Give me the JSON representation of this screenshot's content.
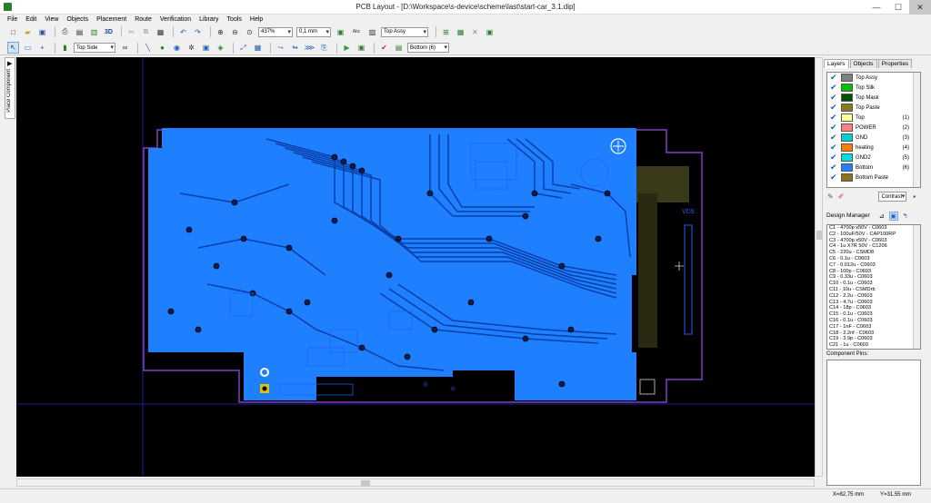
{
  "window": {
    "title": "PCB Layout - [D:\\Workspace\\s-device\\scheme\\last\\start-car_3.1.dip]",
    "min": "—",
    "max": "☐",
    "close": "✕"
  },
  "menu": [
    "File",
    "Edit",
    "View",
    "Objects",
    "Placement",
    "Route",
    "Verification",
    "Library",
    "Tools",
    "Help"
  ],
  "toolbar": {
    "zoom": "437%",
    "grid": "0,1 mm",
    "layer": "Top Assy",
    "side": "Top Side",
    "bottom": "Bottom (6)",
    "view3d": "3D",
    "abc": "Abc"
  },
  "sidetab": {
    "label": "Place Component",
    "arrow": "▶"
  },
  "panel": {
    "tabs": [
      "Layers",
      "Objects",
      "Properties"
    ],
    "layers": [
      {
        "name": "Top Assy",
        "color": "#808080",
        "num": ""
      },
      {
        "name": "Top Silk",
        "color": "#00c000",
        "num": ""
      },
      {
        "name": "Top Mask",
        "color": "#005000",
        "num": ""
      },
      {
        "name": "Top Paste",
        "color": "#8a7a20",
        "num": ""
      },
      {
        "name": "Top",
        "color": "#ffff99",
        "num": "(1)"
      },
      {
        "name": "POWER",
        "color": "#ff8080",
        "num": "(2)"
      },
      {
        "name": "GND",
        "color": "#00d0d0",
        "num": "(3)"
      },
      {
        "name": "heating",
        "color": "#ff8000",
        "num": "(4)"
      },
      {
        "name": "GND2",
        "color": "#00e0e0",
        "num": "(5)"
      },
      {
        "name": "Bottom",
        "color": "#2080ff",
        "num": "(6)"
      },
      {
        "name": "Bottom Paste",
        "color": "#8a7020",
        "num": ""
      }
    ],
    "contrast": "Contrast",
    "design_manager": "Design Manager",
    "components": [
      "C1 - 4700p x50V - C0603",
      "C2 - 100uF/50V - CAP100RP",
      "C3 - 4700p x50V - C0603",
      "C4 - 1u X7R 50V - C1206",
      "C5 - 220u - CSMD8",
      "C6 - 0.1u - C0603",
      "C7 - 0.012u - C0603",
      "C8 - 100p - C0603",
      "C9 - 0.33u - C0603",
      "C10 - 0.1u - C0603",
      "C11 - 10u - CSMDrb",
      "C12 - 2.2u - C0603",
      "C13 - 4.7u - C0603",
      "C14 - 18p - C0603",
      "C15 - 0.1u - C0603",
      "C16 - 0.1u - C0603",
      "C17 - 1nF - C0603",
      "C18 - 2.2nf - C0603",
      "C19 - 3.9p - C0603",
      "C21 - 1u - C0603"
    ],
    "pins_label": "Component Pins:"
  },
  "board_labels": {
    "label1": "VD9"
  },
  "status": {
    "x": "X=82,75 mm",
    "y": "Y=31,55 mm"
  },
  "colors": {
    "copper": "#1e7fff",
    "trace": "#0a3fa8",
    "outline": "#8040c0",
    "silk": "#2060ff"
  }
}
